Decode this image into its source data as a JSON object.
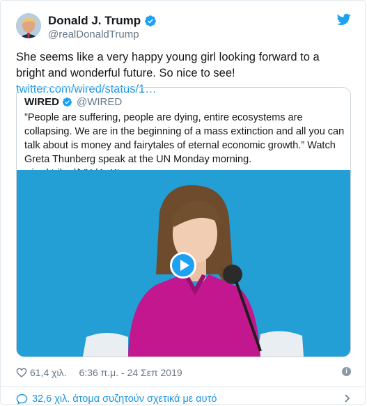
{
  "author": {
    "name": "Donald J. Trump",
    "handle": "@realDonaldTrump"
  },
  "tweet": {
    "text": "She seems like a very happy young girl looking forward to a bright and wonderful future. So nice to see! ",
    "link": "twitter.com/wired/status/1…"
  },
  "quoted": {
    "name": "WIRED",
    "handle": "@WIRED",
    "text": "”People are suffering, people are dying, entire ecosystems are collapsing. We are in the beginning of a mass extinction and all you can talk about is money and fairytales of eternal economic growth.” Watch Greta Thunberg speak at the UN Monday morning. wired.trib.al/VXdAnKt"
  },
  "footer": {
    "likes": "61,4 χιλ.",
    "timestamp": "6:36 π.μ. - 24 Σεπ 2019"
  },
  "conversation": {
    "text": "32,6 χιλ. άτομα συζητούν σχετικά με αυτό"
  },
  "colors": {
    "accent": "#1da1f2",
    "link": "#1b95e0",
    "secondary_text": "#657786",
    "border": "#e1e8ed"
  },
  "icons": [
    "verified-badge-icon",
    "twitter-bird-icon",
    "play-icon",
    "heart-icon",
    "info-icon",
    "speech-bubble-icon",
    "chevron-right-icon"
  ]
}
